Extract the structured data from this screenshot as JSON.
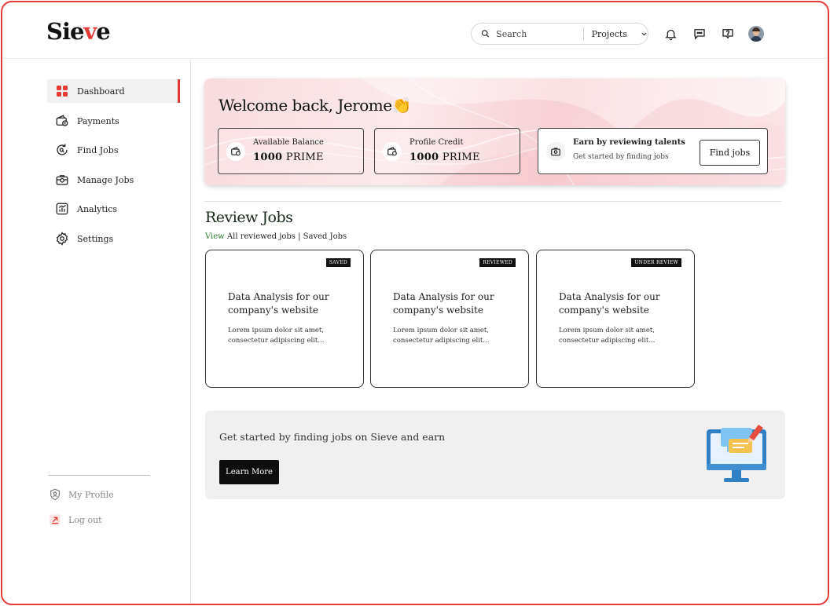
{
  "app": {
    "logo": "Sieve"
  },
  "header": {
    "search_placeholder": "Search",
    "scope_label": "Projects"
  },
  "sidebar": {
    "items": [
      {
        "label": "Dashboard",
        "icon": "dashboard-grid-icon",
        "active": true
      },
      {
        "label": "Payments",
        "icon": "wallet-icon"
      },
      {
        "label": "Find Jobs",
        "icon": "refresh-search-icon"
      },
      {
        "label": "Manage Jobs",
        "icon": "briefcase-icon"
      },
      {
        "label": "Analytics",
        "icon": "chart-icon"
      },
      {
        "label": "Settings",
        "icon": "gear-icon"
      }
    ],
    "profile_label": "My Profile",
    "logout_label": "Log out"
  },
  "welcome": {
    "greeting": "Welcome back, Jerome",
    "emoji": "👏",
    "balance": {
      "label": "Available Balance",
      "amount": "1000",
      "unit": "PRIME"
    },
    "credit": {
      "label": "Profile Credit",
      "amount": "1000",
      "unit": "PRIME"
    },
    "earn": {
      "label": "Earn by reviewing talents",
      "sub": "Get started by finding jobs",
      "button": "Find jobs"
    }
  },
  "review": {
    "title": "Review Jobs",
    "link_view": "View",
    "link_all": "All reviewed jobs",
    "link_sep": "|",
    "link_saved": "Saved Jobs",
    "cards": [
      {
        "badge": "SAVED",
        "title": "Data Analysis for our company's website",
        "desc": "Lorem ipsum dolor sit amet, consectetur adipiscing elit..."
      },
      {
        "badge": "REVIEWED",
        "title": "Data Analysis for our company's website",
        "desc": "Lorem ipsum dolor sit amet, consectetur adipiscing elit..."
      },
      {
        "badge": "UNDER REVIEW",
        "title": "Data Analysis for our company's website",
        "desc": "Lorem ipsum dolor sit amet, consectetur adipiscing elit..."
      }
    ]
  },
  "promo": {
    "text": "Get started by finding jobs on Sieve and earn",
    "button": "Learn More"
  },
  "colors": {
    "accent": "#e53935",
    "dark": "#111111",
    "link": "#2e7d32"
  }
}
